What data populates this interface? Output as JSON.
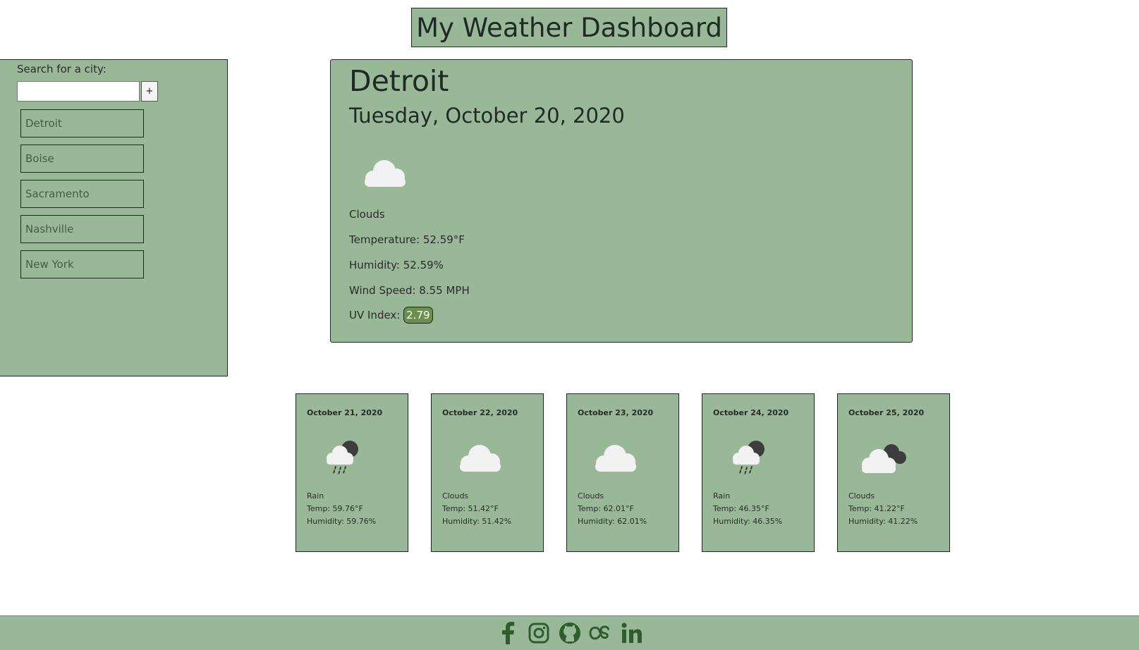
{
  "header": {
    "title": "My Weather Dashboard"
  },
  "sidebar": {
    "search_label": "Search for a city:",
    "search_placeholder": "",
    "add_label": "+",
    "cities": [
      "Detroit",
      "Boise",
      "Sacramento",
      "Nashville",
      "New York"
    ]
  },
  "current": {
    "city": "Detroit",
    "date": "Tuesday, October 20, 2020",
    "icon": "clouds-icon",
    "condition": "Clouds",
    "temperature": "Temperature: 52.59°F",
    "humidity": "Humidity: 52.59%",
    "wind": "Wind Speed: 8.55 MPH",
    "uv_label": "UV Index:",
    "uv_value": "2.79"
  },
  "forecast": [
    {
      "date": "October 21, 2020",
      "icon": "rain-icon",
      "condition": "Rain",
      "temp": "Temp: 59.76°F",
      "humidity": "Humidity: 59.76%"
    },
    {
      "date": "October 22, 2020",
      "icon": "clouds-icon",
      "condition": "Clouds",
      "temp": "Temp: 51.42°F",
      "humidity": "Humidity: 51.42%"
    },
    {
      "date": "October 23, 2020",
      "icon": "clouds-icon",
      "condition": "Clouds",
      "temp": "Temp: 62.01°F",
      "humidity": "Humidity: 62.01%"
    },
    {
      "date": "October 24, 2020",
      "icon": "rain-icon",
      "condition": "Rain",
      "temp": "Temp: 46.35°F",
      "humidity": "Humidity: 46.35%"
    },
    {
      "date": "October 25, 2020",
      "icon": "broken-clouds-icon",
      "condition": "Clouds",
      "temp": "Temp: 41.22°F",
      "humidity": "Humidity: 41.22%"
    }
  ],
  "footer": {
    "icons": [
      "facebook-icon",
      "instagram-icon",
      "github-icon",
      "lastfm-icon",
      "linkedin-icon"
    ]
  },
  "colors": {
    "panel": "#99b898",
    "uv_badge": "#6a8f4f",
    "footer_icon": "#2f5d2b"
  }
}
